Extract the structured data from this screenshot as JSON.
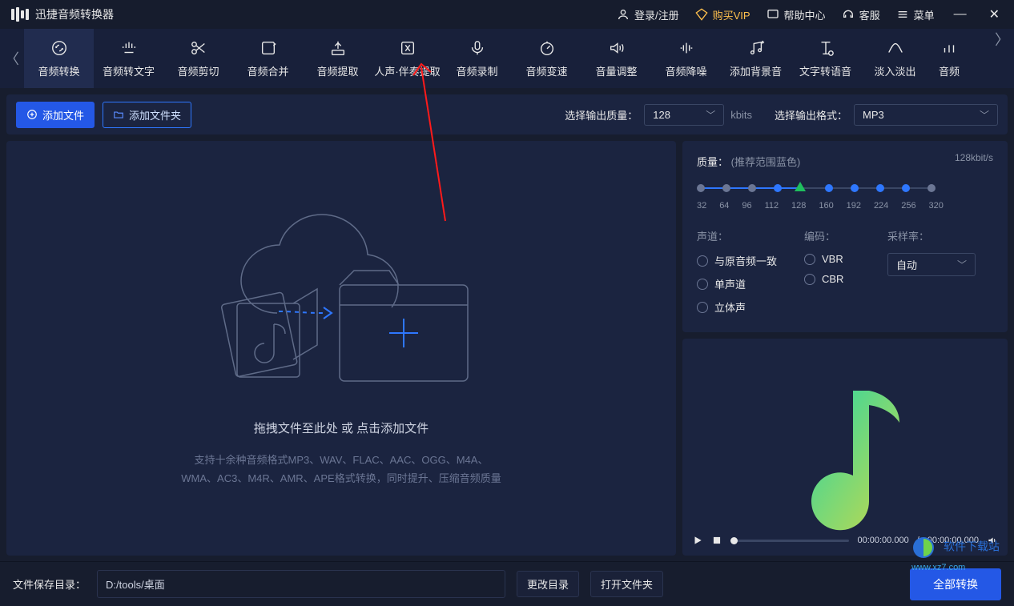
{
  "app": {
    "title": "迅捷音频转换器"
  },
  "header": {
    "login": "登录/注册",
    "vip": "购买VIP",
    "help": "帮助中心",
    "service": "客服",
    "menu": "菜单"
  },
  "tabs": [
    "音频转换",
    "音频转文字",
    "音频剪切",
    "音频合并",
    "音频提取",
    "人声·伴奏提取",
    "音频录制",
    "音频变速",
    "音量调整",
    "音频降噪",
    "添加背景音",
    "文字转语音",
    "淡入淡出",
    "音频"
  ],
  "actions": {
    "add_file": "添加文件",
    "add_folder": "添加文件夹",
    "out_quality": "选择输出质量：",
    "quality_value": "128",
    "quality_unit": "kbits",
    "out_format": "选择输出格式：",
    "format_value": "MP3"
  },
  "quality_panel": {
    "label": "质量：",
    "recommend": "(推荐范围蓝色)",
    "unit": "128kbit/s",
    "ticks": [
      "32",
      "64",
      "96",
      "112",
      "128",
      "160",
      "192",
      "224",
      "256",
      "320"
    ],
    "active_index": 4
  },
  "options": {
    "channel_label": "声道：",
    "channels": [
      "与原音频一致",
      "单声道",
      "立体声"
    ],
    "encoding_label": "编码：",
    "encodings": [
      "VBR",
      "CBR"
    ],
    "sample_label": "采样率：",
    "sample_value": "自动"
  },
  "dropzone": {
    "main": "拖拽文件至此处 或 点击添加文件",
    "sub1": "支持十余种音频格式MP3、WAV、FLAC、AAC、OGG、M4A、",
    "sub2": "WMA、AC3、M4R、AMR、APE格式转换，同时提升、压缩音频质量"
  },
  "player": {
    "time_cur": "00:00:00.000",
    "time_total": "00:00:00.000"
  },
  "bottom": {
    "save_label": "文件保存目录：",
    "path": "D:/tools/桌面",
    "change_dir": "更改目录",
    "open_dir": "打开文件夹",
    "convert_all": "全部转换"
  },
  "watermark": {
    "line1": "软件下载站",
    "line2": "www.xz7.com"
  }
}
